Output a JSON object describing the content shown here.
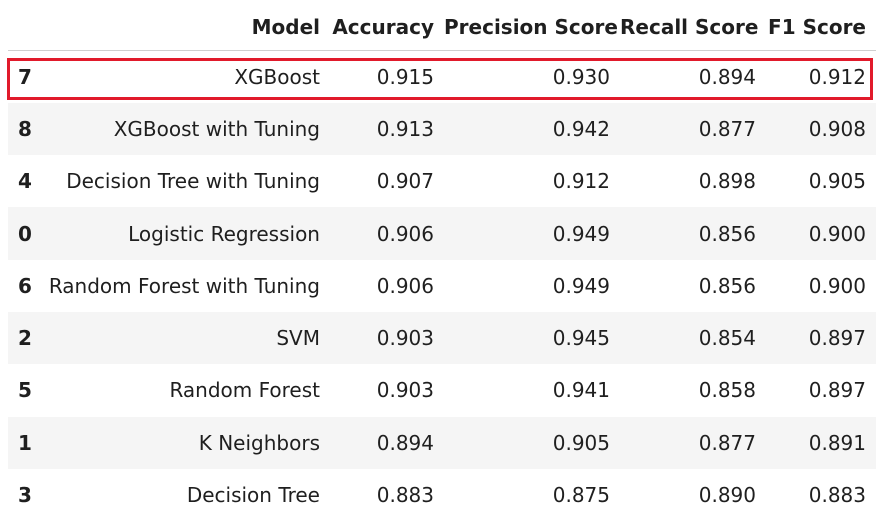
{
  "table": {
    "headers": {
      "index": "",
      "model": "Model",
      "accuracy": "Accuracy",
      "precision": "Precision Score",
      "recall": "Recall Score",
      "f1": "F1 Score"
    },
    "rows": [
      {
        "index": "7",
        "model": "XGBoost",
        "accuracy": "0.915",
        "precision": "0.930",
        "recall": "0.894",
        "f1": "0.912"
      },
      {
        "index": "8",
        "model": "XGBoost with Tuning",
        "accuracy": "0.913",
        "precision": "0.942",
        "recall": "0.877",
        "f1": "0.908"
      },
      {
        "index": "4",
        "model": "Decision Tree with Tuning",
        "accuracy": "0.907",
        "precision": "0.912",
        "recall": "0.898",
        "f1": "0.905"
      },
      {
        "index": "0",
        "model": "Logistic Regression",
        "accuracy": "0.906",
        "precision": "0.949",
        "recall": "0.856",
        "f1": "0.900"
      },
      {
        "index": "6",
        "model": "Random Forest with Tuning",
        "accuracy": "0.906",
        "precision": "0.949",
        "recall": "0.856",
        "f1": "0.900"
      },
      {
        "index": "2",
        "model": "SVM",
        "accuracy": "0.903",
        "precision": "0.945",
        "recall": "0.854",
        "f1": "0.897"
      },
      {
        "index": "5",
        "model": "Random Forest",
        "accuracy": "0.903",
        "precision": "0.941",
        "recall": "0.858",
        "f1": "0.897"
      },
      {
        "index": "1",
        "model": "K Neighbors",
        "accuracy": "0.894",
        "precision": "0.905",
        "recall": "0.877",
        "f1": "0.891"
      },
      {
        "index": "3",
        "model": "Decision Tree",
        "accuracy": "0.883",
        "precision": "0.875",
        "recall": "0.890",
        "f1": "0.883"
      }
    ]
  },
  "highlight": {
    "row_index": "7",
    "color": "#e11a2b"
  }
}
